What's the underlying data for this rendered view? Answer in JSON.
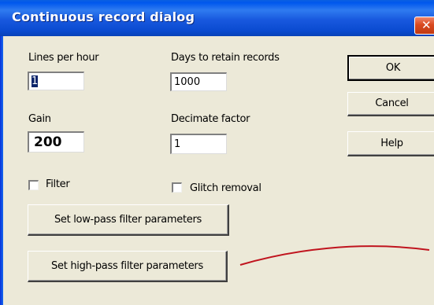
{
  "window": {
    "title": "Continuous record dialog",
    "close_glyph": "✕"
  },
  "fields": {
    "lines_per_hour": {
      "label": "Lines per hour",
      "value": "1"
    },
    "days_to_retain": {
      "label": "Days to retain records",
      "value": "1000"
    },
    "gain": {
      "label": "Gain",
      "value": "200"
    },
    "decimate_factor": {
      "label": "Decimate factor",
      "value": "1"
    }
  },
  "checkboxes": {
    "filter": {
      "label": "Filter",
      "checked": false
    },
    "glitch_removal": {
      "label": "Glitch removal",
      "checked": false
    }
  },
  "buttons": {
    "ok": "OK",
    "cancel": "Cancel",
    "help": "Help",
    "low_pass": "Set low-pass filter parameters",
    "high_pass": "Set high-pass filter parameters"
  },
  "colors": {
    "title_bar": "#0058EE",
    "dialog_bg": "#ECE9D8",
    "close_button": "#D94A20",
    "annotation_line": "#C0141E"
  }
}
